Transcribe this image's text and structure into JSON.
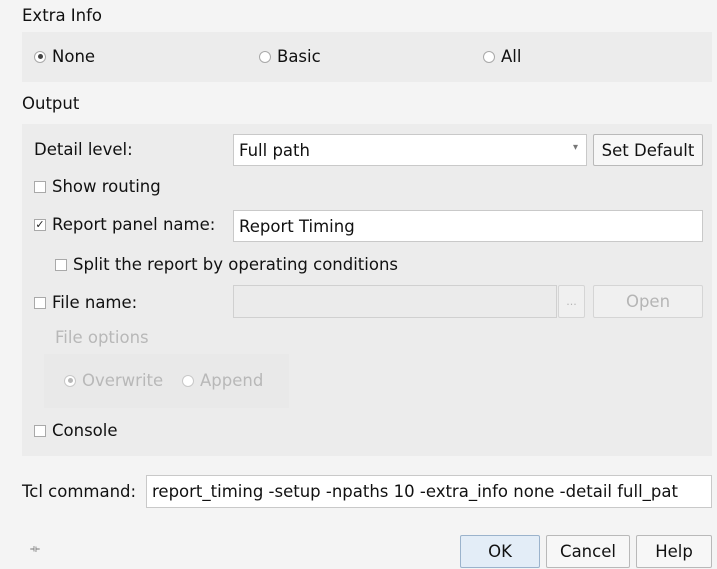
{
  "extra_info": {
    "title": "Extra Info",
    "options": [
      {
        "label": "None",
        "selected": true
      },
      {
        "label": "Basic",
        "selected": false
      },
      {
        "label": "All",
        "selected": false
      }
    ]
  },
  "output": {
    "title": "Output",
    "detail_level_label": "Detail level:",
    "detail_level_value": "Full path",
    "set_default_label": "Set Default",
    "show_routing_label": "Show routing",
    "show_routing_checked": false,
    "report_panel_label": "Report panel name:",
    "report_panel_checked": true,
    "report_panel_value": "Report Timing",
    "split_report_label": "Split the report by operating conditions",
    "split_report_checked": false,
    "file_name_label": "File name:",
    "file_name_checked": false,
    "file_name_value": "",
    "browse_label": "...",
    "open_label": "Open",
    "file_options_label": "File options",
    "overwrite_label": "Overwrite",
    "append_label": "Append",
    "console_label": "Console",
    "console_checked": false
  },
  "tcl": {
    "label": "Tcl command:",
    "value": "report_timing -setup -npaths 10 -extra_info none -detail full_pat"
  },
  "footer": {
    "ok_label": "OK",
    "cancel_label": "Cancel",
    "help_label": "Help",
    "grip_glyph": "⟛"
  },
  "colors": {
    "background": "#f4f4f4",
    "group": "#ececec",
    "primary_button": "#e3edf7"
  }
}
